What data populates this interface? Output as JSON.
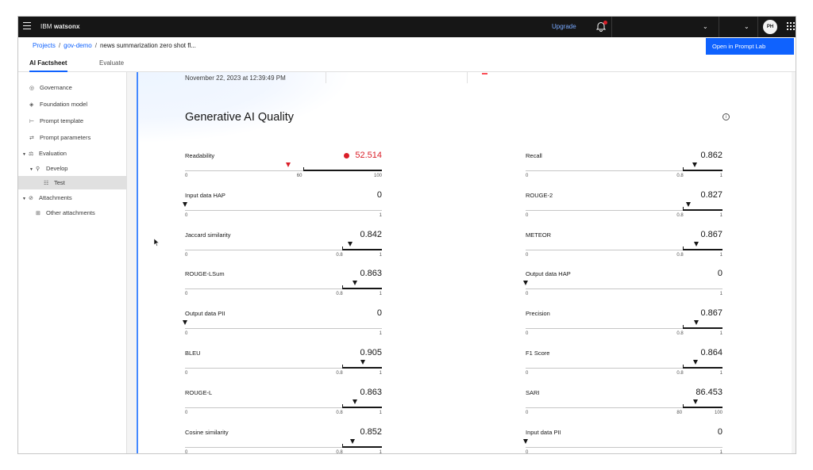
{
  "topbar": {
    "brand_prefix": "IBM",
    "brand_name": "watsonx",
    "upgrade": "Upgrade",
    "avatar": "PH"
  },
  "breadcrumb": {
    "projects": "Projects",
    "project": "gov-demo",
    "current": "news summarization zero shot fl..."
  },
  "open_prompt_lab": "Open in Prompt Lab",
  "tabs": [
    {
      "label": "AI Factsheet",
      "active": true
    },
    {
      "label": "Evaluate",
      "active": false
    }
  ],
  "sidebar": [
    {
      "label": "Governance",
      "icon": "governance-icon"
    },
    {
      "label": "Foundation model",
      "icon": "model-icon"
    },
    {
      "label": "Prompt template",
      "icon": "template-icon"
    },
    {
      "label": "Prompt parameters",
      "icon": "parameters-icon"
    },
    {
      "label": "Evaluation",
      "icon": "scale-icon"
    },
    {
      "label": "Develop",
      "icon": "develop-icon"
    },
    {
      "label": "Test",
      "icon": "test-icon"
    },
    {
      "label": "Attachments",
      "icon": "attachment-icon"
    },
    {
      "label": "Other attachments",
      "icon": "attachments-list-icon"
    }
  ],
  "header": {
    "date": "November 22, 2023 at 12:39:49 PM"
  },
  "section_title": "Generative AI Quality",
  "metrics_left": [
    {
      "name": "Readability",
      "value": "52.514",
      "alert": true,
      "min": "0",
      "threshold": "60",
      "max": "100",
      "pos": 0.52514,
      "thr": 0.6
    },
    {
      "name": "Input data HAP",
      "value": "0",
      "min": "0",
      "threshold": "",
      "max": "1",
      "pos": 0,
      "thr": null
    },
    {
      "name": "Jaccard similarity",
      "value": "0.842",
      "min": "0",
      "threshold": "0.8",
      "max": "1",
      "pos": 0.842,
      "thr": 0.8
    },
    {
      "name": "ROUGE-LSum",
      "value": "0.863",
      "min": "0",
      "threshold": "0.8",
      "max": "1",
      "pos": 0.863,
      "thr": 0.8
    },
    {
      "name": "Output data PII",
      "value": "0",
      "min": "0",
      "threshold": "",
      "max": "1",
      "pos": 0,
      "thr": null
    },
    {
      "name": "BLEU",
      "value": "0.905",
      "min": "0",
      "threshold": "0.8",
      "max": "1",
      "pos": 0.905,
      "thr": 0.8
    },
    {
      "name": "ROUGE-L",
      "value": "0.863",
      "min": "0",
      "threshold": "0.8",
      "max": "1",
      "pos": 0.863,
      "thr": 0.8
    },
    {
      "name": "Cosine similarity",
      "value": "0.852",
      "min": "0",
      "threshold": "0.8",
      "max": "1",
      "pos": 0.852,
      "thr": 0.8
    }
  ],
  "metrics_right": [
    {
      "name": "Recall",
      "value": "0.862",
      "min": "0",
      "threshold": "0.8",
      "max": "1",
      "pos": 0.862,
      "thr": 0.8
    },
    {
      "name": "ROUGE-2",
      "value": "0.827",
      "min": "0",
      "threshold": "0.8",
      "max": "1",
      "pos": 0.827,
      "thr": 0.8
    },
    {
      "name": "METEOR",
      "value": "0.867",
      "min": "0",
      "threshold": "0.8",
      "max": "1",
      "pos": 0.867,
      "thr": 0.8
    },
    {
      "name": "Output data HAP",
      "value": "0",
      "min": "0",
      "threshold": "",
      "max": "1",
      "pos": 0,
      "thr": null
    },
    {
      "name": "Precision",
      "value": "0.867",
      "min": "0",
      "threshold": "0.8",
      "max": "1",
      "pos": 0.867,
      "thr": 0.8
    },
    {
      "name": "F1 Score",
      "value": "0.864",
      "min": "0",
      "threshold": "0.8",
      "max": "1",
      "pos": 0.864,
      "thr": 0.8
    },
    {
      "name": "SARI",
      "value": "86.453",
      "min": "0",
      "threshold": "80",
      "max": "100",
      "pos": 0.86453,
      "thr": 0.8
    },
    {
      "name": "Input data PII",
      "value": "0",
      "min": "0",
      "threshold": "",
      "max": "1",
      "pos": 0,
      "thr": null
    }
  ],
  "colors": {
    "accent": "#0f62fe",
    "alert": "#da1e28",
    "topbar": "#161616"
  }
}
